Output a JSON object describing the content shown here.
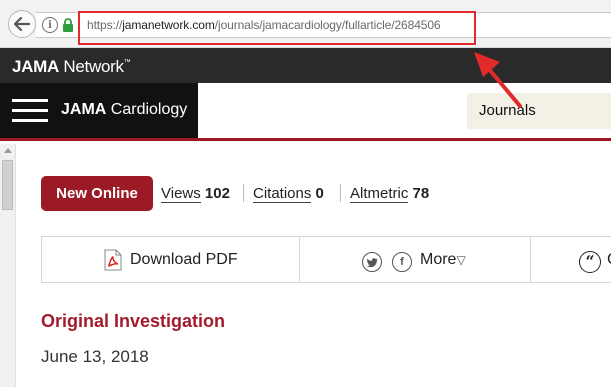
{
  "browser": {
    "url_prefix": "https://",
    "url_host": "jamanetwork.com",
    "url_path": "/journals/jamacardiology/fullarticle/2684506"
  },
  "network": {
    "logo_bold": "JAMA",
    "logo_light": " Network",
    "logo_tm": "™"
  },
  "journal": {
    "name_bold": "JAMA",
    "name_light": " Cardiology",
    "journals_button": "Journals"
  },
  "article_meta": {
    "badge": "New Online",
    "views_label": "Views",
    "views_count": "102",
    "citations_label": "Citations",
    "citations_count": "0",
    "altmetric_label": "Altmetric",
    "altmetric_count": "78"
  },
  "toolbar": {
    "download_label": "Download PDF",
    "more_label": "More",
    "more_caret": "▽",
    "cite_partial": "C"
  },
  "article": {
    "type": "Original Investigation",
    "date": "June 13, 2018"
  },
  "colors": {
    "brand_red": "#9b1a25",
    "annotation_red": "#e12a2a",
    "header_dark": "#2a2a2a"
  },
  "icons": [
    "back-arrow-icon",
    "info-icon",
    "lock-icon",
    "hamburger-icon",
    "pdf-icon",
    "twitter-icon",
    "facebook-icon",
    "cite-icon"
  ]
}
